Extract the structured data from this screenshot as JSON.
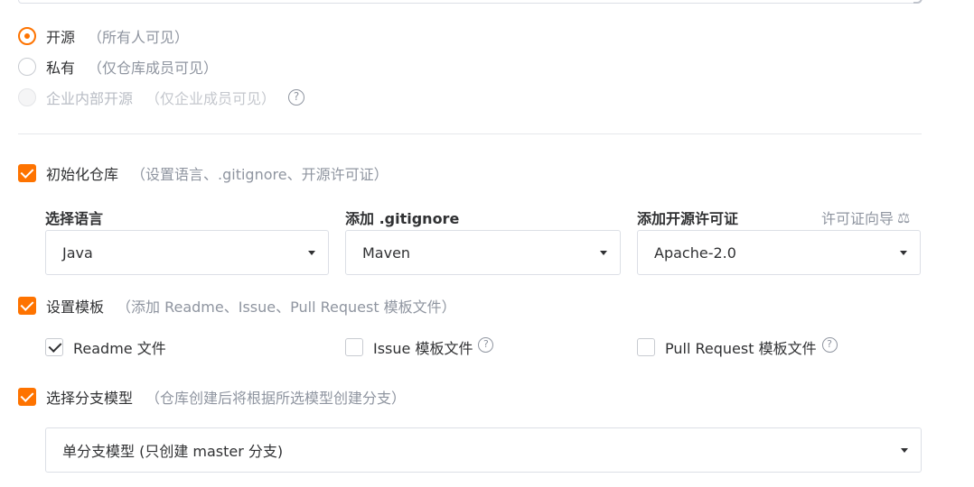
{
  "visibility": {
    "options": [
      {
        "label": "开源",
        "hint": "（所有人可见）",
        "checked": true,
        "disabled": false
      },
      {
        "label": "私有",
        "hint": "（仅仓库成员可见）",
        "checked": false,
        "disabled": false
      },
      {
        "label": "企业内部开源",
        "hint": "（仅企业成员可见）",
        "checked": false,
        "disabled": true
      }
    ],
    "help_glyph": "?"
  },
  "init_repo": {
    "label": "初始化仓库",
    "hint": "（设置语言、.gitignore、开源许可证）",
    "checked": true,
    "language": {
      "label": "选择语言",
      "value": "Java"
    },
    "gitignore": {
      "label": "添加 .gitignore",
      "value": "Maven"
    },
    "license": {
      "label": "添加开源许可证",
      "value": "Apache-2.0",
      "guide_link": "许可证向导",
      "guide_icon": "scale-icon"
    }
  },
  "templates": {
    "label": "设置模板",
    "hint": "（添加 Readme、Issue、Pull Request 模板文件）",
    "checked": true,
    "items": [
      {
        "label": "Readme 文件",
        "checked": true
      },
      {
        "label": "Issue 模板文件",
        "checked": false
      },
      {
        "label": "Pull Request 模板文件",
        "checked": false
      }
    ]
  },
  "branch_model": {
    "label": "选择分支模型",
    "hint": "（仓库创建后将根据所选模型创建分支）",
    "checked": true,
    "value": "单分支模型 (只创建 master 分支)"
  },
  "colors": {
    "accent": "#fe7300",
    "muted": "#8f95a0",
    "border": "#dcdfe6"
  }
}
